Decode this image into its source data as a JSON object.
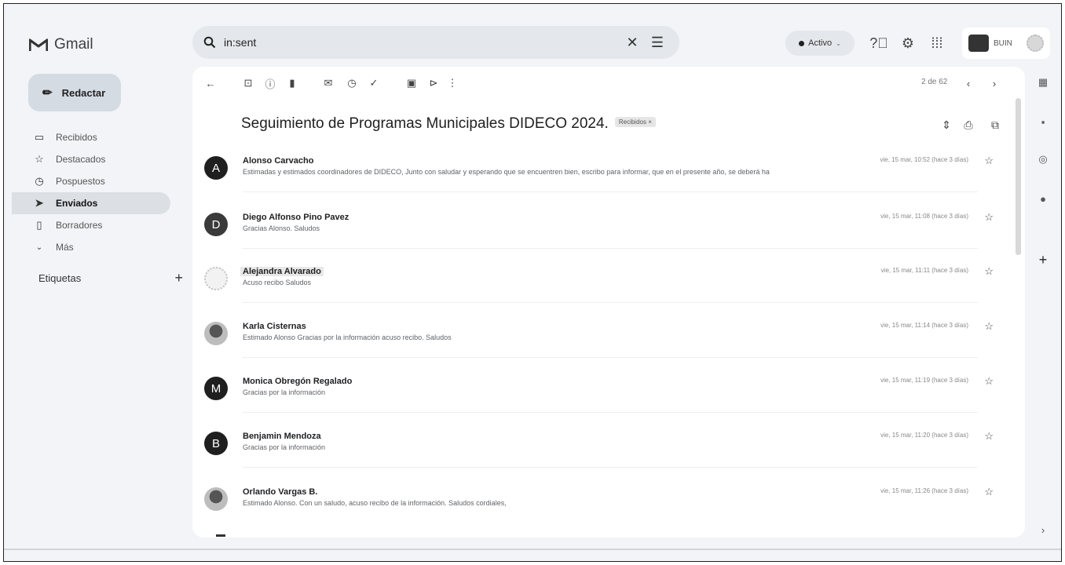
{
  "app": {
    "title": "Gmail"
  },
  "search": {
    "query": "in:sent"
  },
  "status": {
    "label": "Activo"
  },
  "account": {
    "name": "BUIN"
  },
  "compose": {
    "label": "Redactar"
  },
  "sidebar": {
    "items": [
      {
        "label": "Recibidos",
        "icon": "inbox-icon"
      },
      {
        "label": "Destacados",
        "icon": "star-icon"
      },
      {
        "label": "Pospuestos",
        "icon": "clock-icon"
      },
      {
        "label": "Enviados",
        "icon": "send-icon",
        "active": true
      },
      {
        "label": "Borradores",
        "icon": "draft-icon"
      },
      {
        "label": "Más",
        "icon": "chevron-down-icon"
      }
    ],
    "labels_title": "Etiquetas"
  },
  "toolbar": {
    "pager": "2 de 62"
  },
  "thread": {
    "subject": "Seguimiento de Programas Municipales DIDECO 2024.",
    "tag": "Recibidos ×",
    "messages": [
      {
        "avatar": "A",
        "sender": "Alonso Carvacho",
        "snippet": "Estimadas y estimados coordinadores de DIDECO, Junto con saludar y esperando que se encuentren bien, escribo para informar, que en el presente año, se deberá ha",
        "date": "vie, 15 mar, 10:52 (hace 3 días)"
      },
      {
        "avatar": "D",
        "sender": "Diego Alfonso Pino Pavez",
        "snippet": "Gracias Alonso. Saludos",
        "date": "vie, 15 mar, 11:08 (hace 3 días)"
      },
      {
        "avatar": "",
        "sender": "Alejandra Alvarado",
        "snippet": "Acuso recibo Saludos",
        "date": "vie, 15 mar, 11:11 (hace 3 días)"
      },
      {
        "avatar": "",
        "sender": "Karla Cisternas",
        "snippet": "Estimado Alonso Gracias por la información acuso recibo. Saludos",
        "date": "vie, 15 mar, 11:14 (hace 3 días)"
      },
      {
        "avatar": "M",
        "sender": "Monica Obregón Regalado",
        "snippet": "Gracias por la información",
        "date": "vie, 15 mar, 11:19 (hace 3 días)"
      },
      {
        "avatar": "B",
        "sender": "Benjamin Mendoza",
        "snippet": "Gracias por la información",
        "date": "vie, 15 mar, 11:20 (hace 3 días)"
      },
      {
        "avatar": "",
        "sender": "Orlando Vargas B.",
        "snippet": "Estimado Alonso. Con un saludo, acuso recibo de la información. Saludos cordiales,",
        "date": "vie, 15 mar, 11:26 (hace 3 días)"
      }
    ]
  }
}
